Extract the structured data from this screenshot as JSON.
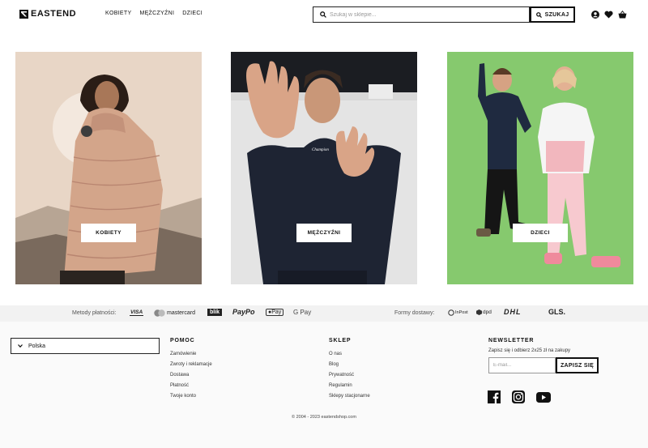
{
  "header": {
    "logo": "EASTEND",
    "nav": [
      "KOBIETY",
      "MĘŻCZYŹNI",
      "DZIECI"
    ],
    "search_placeholder": "Szukaj w sklepie...",
    "search_button": "SZUKAJ"
  },
  "cards": [
    {
      "label": "KOBIETY",
      "bg": "#e6d2c0"
    },
    {
      "label": "MĘŻCZYŹNI",
      "bg": "#1a1c22"
    },
    {
      "label": "DZIECI",
      "bg": "#86c96e"
    }
  ],
  "payments": {
    "label": "Metody płatności:",
    "methods": [
      "VISA",
      "mastercard",
      "blik",
      "PayPo",
      "Pay",
      "G Pay"
    ],
    "shipping_label": "Formy dostawy:",
    "carriers": [
      "InPost",
      "dpd",
      "DHL",
      "GLS."
    ]
  },
  "footer": {
    "country": "Polska",
    "pomoc": {
      "title": "POMOC",
      "links": [
        "Zamówienie",
        "Zwroty i reklamacje",
        "Dostawa",
        "Płatność",
        "Twoje konto"
      ]
    },
    "sklep": {
      "title": "SKLEP",
      "links": [
        "O nas",
        "Blog",
        "Prywatność",
        "Regulamin",
        "Sklepy stacjonarne"
      ]
    },
    "newsletter": {
      "title": "NEWSLETTER",
      "text": "Zapisz się i odbierz 2x25 zł na zakupy",
      "placeholder": "E-mail...",
      "button": "ZAPISZ SIĘ"
    },
    "social": [
      "facebook-icon",
      "instagram-icon",
      "youtube-icon"
    ],
    "copyright": "© 2004 - 2023 eastendshop.com"
  }
}
